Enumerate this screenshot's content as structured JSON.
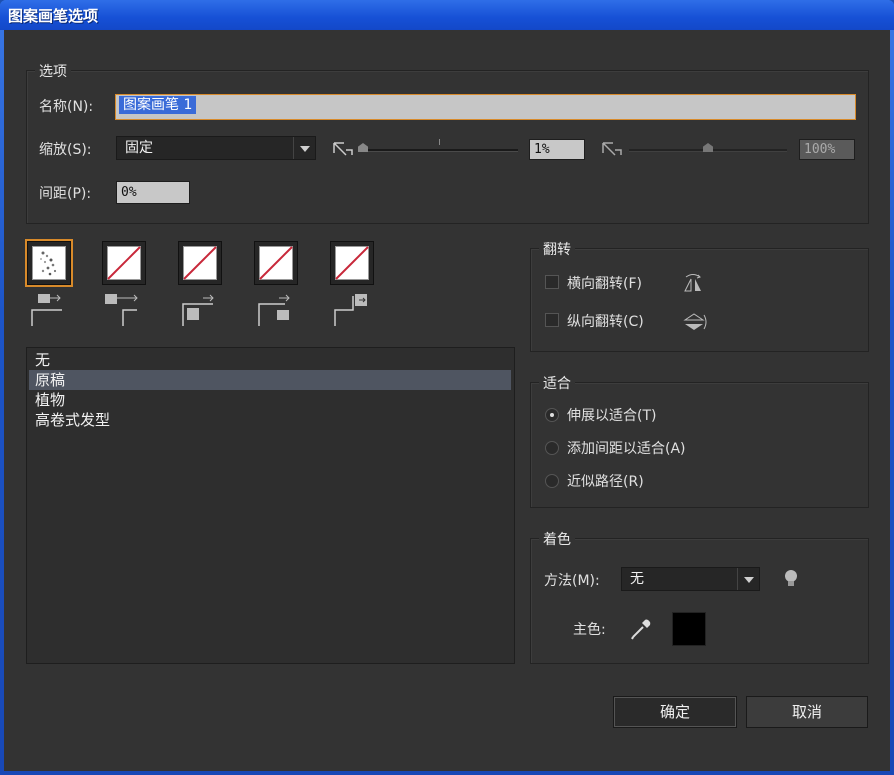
{
  "window": {
    "title": "图案画笔选项"
  },
  "options": {
    "group_label": "选项",
    "name_label": "名称(N):",
    "name_value": "图案画笔 1",
    "scale_label": "缩放(S):",
    "scale_value": "固定",
    "scale_min_value": "1%",
    "scale_max_value": "100%",
    "spacing_label": "间距(P):",
    "spacing_value": "0%"
  },
  "tiles": {
    "items": [
      "side-tile",
      "outer-corner-tile",
      "inner-corner-tile",
      "start-tile",
      "end-tile"
    ],
    "selected_index": 0
  },
  "pattern_list": {
    "items": [
      "无",
      "原稿",
      "植物",
      "高卷式发型"
    ],
    "selected_index": 1
  },
  "flip": {
    "group_label": "翻转",
    "horizontal_label": "横向翻转(F)",
    "vertical_label": "纵向翻转(C)",
    "horizontal_checked": false,
    "vertical_checked": false
  },
  "fit": {
    "group_label": "适合",
    "options": [
      "伸展以适合(T)",
      "添加间距以适合(A)",
      "近似路径(R)"
    ],
    "selected_index": 0
  },
  "colorization": {
    "group_label": "着色",
    "method_label": "方法(M):",
    "method_value": "无",
    "key_color_label": "主色:",
    "key_color": "#000000"
  },
  "buttons": {
    "ok": "确定",
    "cancel": "取消"
  },
  "colors": {
    "accent_orange": "#d88a2a",
    "title_blue": "#1650d6",
    "panel": "#333333",
    "no_tile_red": "#c8283a"
  }
}
